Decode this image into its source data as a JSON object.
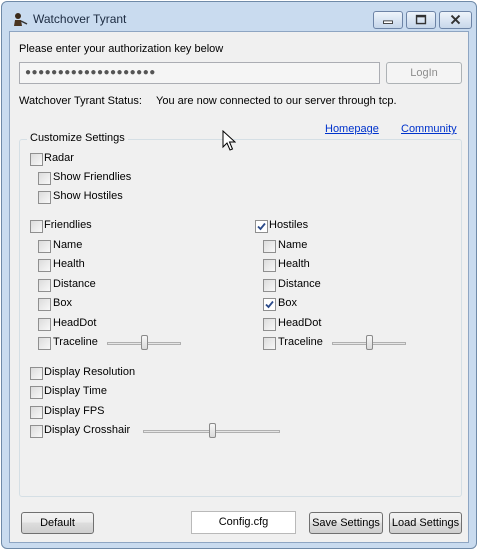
{
  "window": {
    "title": "Watchover Tyrant"
  },
  "auth": {
    "prompt": "Please enter your authorization key below",
    "key_value": "●●●●●●●●●●●●●●●●●●●●",
    "login_label": "LogIn"
  },
  "status": {
    "label": "Watchover Tyrant Status:",
    "message": "You are now connected to our server through tcp."
  },
  "links": {
    "homepage": "Homepage",
    "community": "Community"
  },
  "settings": {
    "title": "Customize Settings",
    "radar": {
      "label": "Radar",
      "checked": false,
      "show_friendlies": {
        "label": "Show Friendlies",
        "checked": false
      },
      "show_hostiles": {
        "label": "Show Hostiles",
        "checked": false
      }
    },
    "friendlies": {
      "label": "Friendlies",
      "checked": false,
      "options": [
        {
          "label": "Name",
          "checked": false
        },
        {
          "label": "Health",
          "checked": false
        },
        {
          "label": "Distance",
          "checked": false
        },
        {
          "label": "Box",
          "checked": false
        },
        {
          "label": "HeadDot",
          "checked": false
        },
        {
          "label": "Traceline",
          "checked": false
        }
      ],
      "traceline_slider": 0.5
    },
    "hostiles": {
      "label": "Hostiles",
      "checked": true,
      "options": [
        {
          "label": "Name",
          "checked": false
        },
        {
          "label": "Health",
          "checked": false
        },
        {
          "label": "Distance",
          "checked": false
        },
        {
          "label": "Box",
          "checked": true
        },
        {
          "label": "HeadDot",
          "checked": false
        },
        {
          "label": "Traceline",
          "checked": false
        }
      ],
      "traceline_slider": 0.5
    },
    "display": [
      {
        "label": "Display Resolution",
        "checked": false
      },
      {
        "label": "Display Time",
        "checked": false
      },
      {
        "label": "Display FPS",
        "checked": false
      },
      {
        "label": "Display Crosshair",
        "checked": false
      }
    ],
    "crosshair_slider": 0.5
  },
  "footer": {
    "default_label": "Default",
    "config_file": "Config.cfg",
    "save_label": "Save Settings",
    "load_label": "Load Settings"
  }
}
